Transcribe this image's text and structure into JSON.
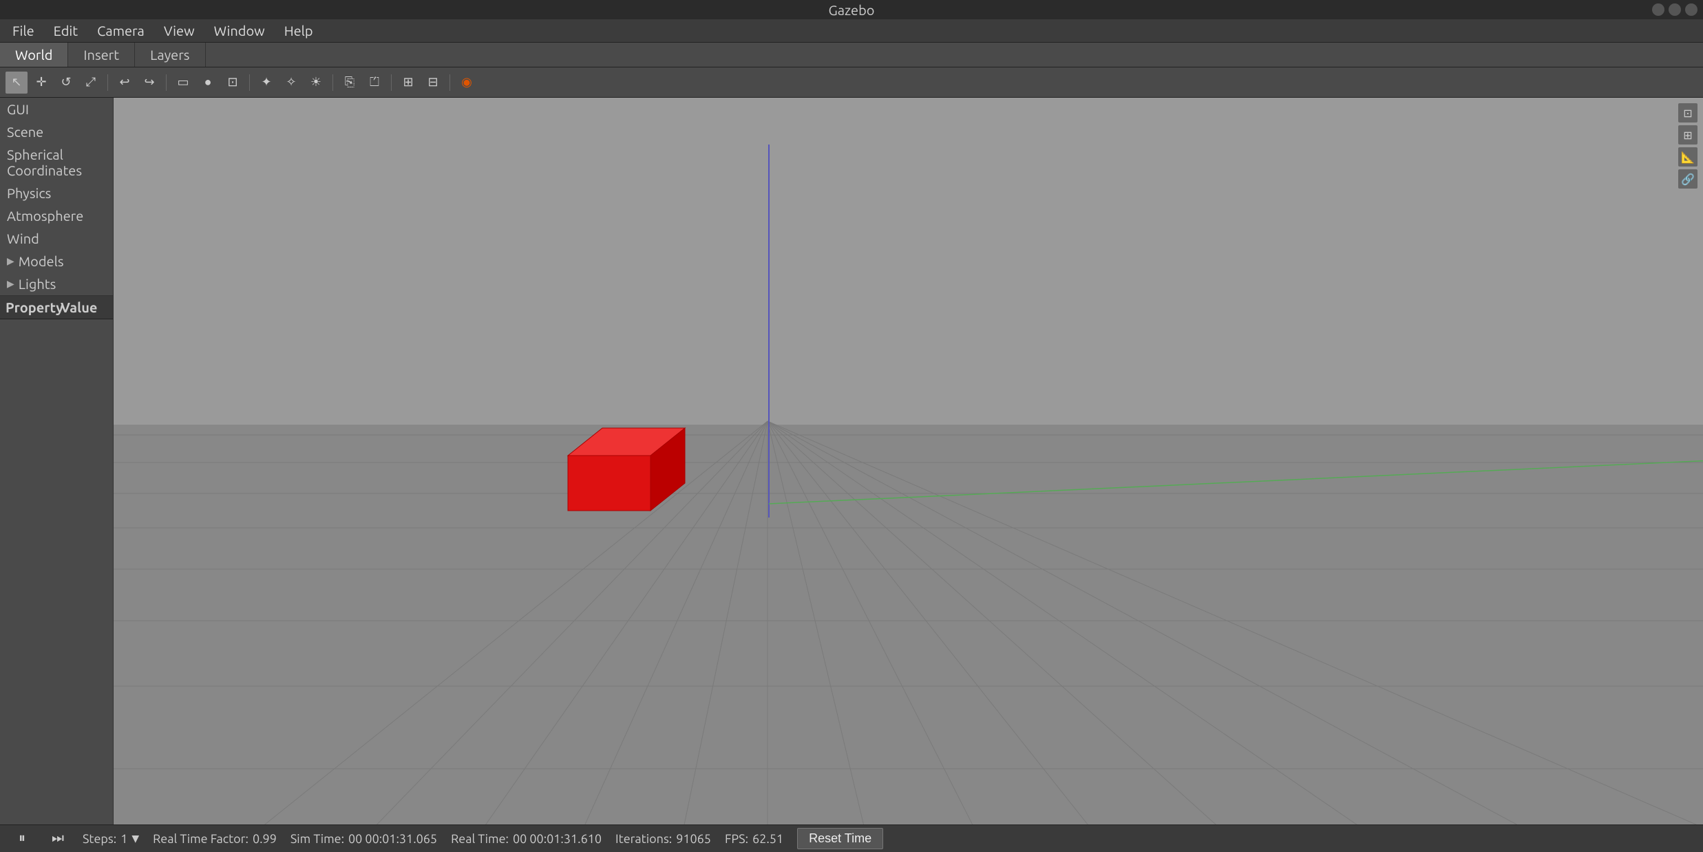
{
  "titlebar": {
    "title": "Gazebo"
  },
  "menubar": {
    "items": [
      "File",
      "Edit",
      "Camera",
      "View",
      "Window",
      "Help"
    ]
  },
  "tabs": {
    "items": [
      "World",
      "Insert",
      "Layers"
    ],
    "active": 0
  },
  "toolbar": {
    "buttons": [
      {
        "name": "select-mode",
        "icon": "↖",
        "active": true
      },
      {
        "name": "translate-mode",
        "icon": "✛",
        "active": false
      },
      {
        "name": "rotate-mode",
        "icon": "↺",
        "active": false
      },
      {
        "name": "scale-mode",
        "icon": "⤢",
        "active": false
      },
      {
        "name": "undo",
        "icon": "↩",
        "active": false
      },
      {
        "name": "redo",
        "icon": "↪",
        "active": false
      },
      {
        "name": "box-shape",
        "icon": "□",
        "active": false
      },
      {
        "name": "sphere-shape",
        "icon": "○",
        "active": false
      },
      {
        "name": "cylinder-shape",
        "icon": "⊡",
        "active": false
      },
      {
        "name": "point-light",
        "icon": "✦",
        "active": false
      },
      {
        "name": "spot-light",
        "icon": "✧",
        "active": false
      },
      {
        "name": "directional-light",
        "icon": "☀",
        "active": false
      },
      {
        "name": "copy",
        "icon": "⎘",
        "active": false
      },
      {
        "name": "paste",
        "icon": "⏍",
        "active": false
      },
      {
        "name": "align",
        "icon": "⊞",
        "active": false
      },
      {
        "name": "snap",
        "icon": "⊟",
        "active": false
      },
      {
        "name": "record",
        "icon": "◉",
        "active": false
      }
    ]
  },
  "sidebar": {
    "items": [
      {
        "label": "GUI",
        "arrow": false
      },
      {
        "label": "Scene",
        "arrow": false
      },
      {
        "label": "Spherical Coordinates",
        "arrow": false
      },
      {
        "label": "Physics",
        "arrow": false
      },
      {
        "label": "Atmosphere",
        "arrow": false
      },
      {
        "label": "Wind",
        "arrow": false
      },
      {
        "label": "Models",
        "arrow": true
      },
      {
        "label": "Lights",
        "arrow": true
      }
    ]
  },
  "property_panel": {
    "columns": [
      "Property",
      "Value"
    ]
  },
  "statusbar": {
    "pause_icon": "⏸",
    "step_icon": "⏭",
    "steps_label": "Steps:",
    "steps_value": "1",
    "realtime_factor_label": "Real Time Factor:",
    "realtime_factor_value": "0.99",
    "sim_time_label": "Sim Time:",
    "sim_time_value": "00 00:01:31.065",
    "real_time_label": "Real Time:",
    "real_time_value": "00 00:01:31.610",
    "iterations_label": "Iterations:",
    "iterations_value": "91065",
    "fps_label": "FPS:",
    "fps_value": "62.51",
    "reset_button": "Reset Time"
  },
  "viewport": {
    "bg_color": "#909090",
    "grid_color": "#7a7a7a",
    "axis_color_blue": "#5555cc",
    "axis_color_green": "#55cc55",
    "box_color": "#ee1111"
  }
}
